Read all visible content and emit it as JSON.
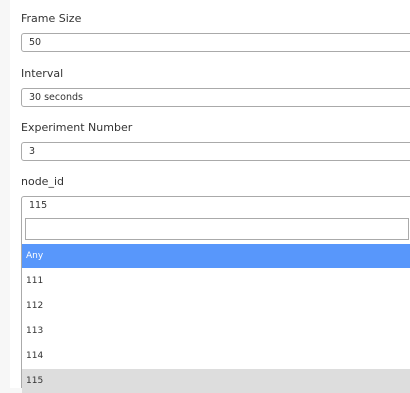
{
  "form": {
    "frame_size": {
      "label": "Frame Size",
      "value": "50"
    },
    "interval": {
      "label": "Interval",
      "value": "30 seconds"
    },
    "experiment_number": {
      "label": "Experiment Number",
      "value": "3"
    },
    "node_id": {
      "label": "node_id",
      "value": "115"
    }
  },
  "dropdown": {
    "search_value": "",
    "options": [
      {
        "label": "Any",
        "state": "highlighted"
      },
      {
        "label": "111",
        "state": "normal"
      },
      {
        "label": "112",
        "state": "normal"
      },
      {
        "label": "113",
        "state": "normal"
      },
      {
        "label": "114",
        "state": "normal"
      },
      {
        "label": "115",
        "state": "selected"
      }
    ]
  },
  "colors": {
    "highlight": "#5897fb",
    "selected": "#dddddd",
    "border": "#aaaaaa"
  }
}
